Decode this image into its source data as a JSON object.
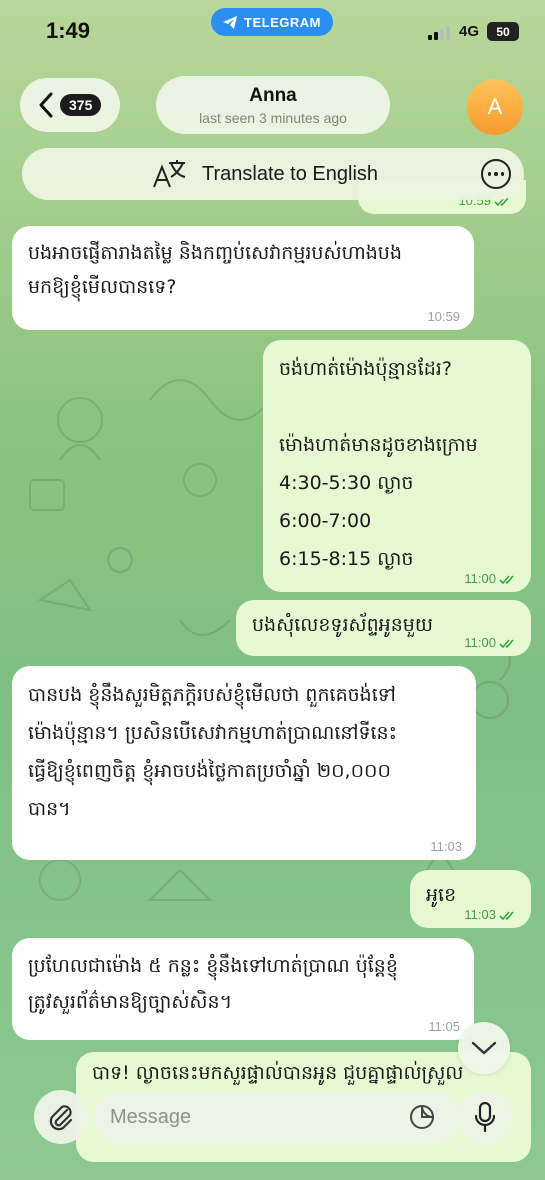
{
  "status_bar": {
    "time": "1:49",
    "banner": "TELEGRAM",
    "network": "4G",
    "battery": "50"
  },
  "header": {
    "unread_count": "375",
    "contact_name": "Anna",
    "last_seen": "last seen 3 minutes ago",
    "avatar_initial": "A"
  },
  "translate_bar": {
    "label": "Translate to English"
  },
  "partial_top_message": {
    "time": "10:59"
  },
  "messages": [
    {
      "direction": "in",
      "text": "បងអាចផ្ញើតារាងតម្លៃ និងកញ្ចប់សេវាកម្មរបស់ហាងបង\nមកឱ្យខ្ញុំមើលបានទេ?",
      "time": "10:59"
    },
    {
      "direction": "out",
      "text": "ចង់ហាត់ម៉ោងប៉ុន្មានដែរ?\n\nម៉ោងហាត់មានដូចខាងក្រោម\n4:30-5:30 ល្ងាច\n6:00-7:00\n6:15-8:15 ល្ងាច",
      "time": "11:00"
    },
    {
      "direction": "out",
      "text": "បងសុំលេខទូរស័ព្ទអូនមួយ",
      "time": "11:00"
    },
    {
      "direction": "in",
      "text": "បានបង ខ្ញុំនឹងសួរមិត្តភក្តិរបស់ខ្ញុំមើលថា ពួកគេចង់ទៅ\nម៉ោងប៉ុន្មាន។ ប្រសិនបើសេវាកម្មហាត់ប្រាណនៅទីនេះ\nធ្វើឱ្យខ្ញុំពេញចិត្ត ខ្ញុំអាចបង់ថ្លៃកាតប្រចាំឆ្នាំ ២០,០០០\nបាន។",
      "time": "11:03"
    },
    {
      "direction": "out",
      "text": "អូខេ",
      "time": "11:03"
    },
    {
      "direction": "in",
      "text": "ប្រហែលជាម៉ោង ៥ កន្លះ ខ្ញុំនឹងទៅហាត់ប្រាណ ប៉ុន្តែខ្ញុំ\nត្រូវសួរព័ត៌មានឱ្យច្បាស់សិន។",
      "time": "11:05"
    },
    {
      "direction": "out",
      "text": "បាទ! ល្ងាចនេះមកសួរផ្ទាល់បានអូន ជួបគ្នាផ្ទាល់ស្រួល",
      "time": ""
    }
  ],
  "composer": {
    "placeholder": "Message"
  },
  "colors": {
    "incoming": "#ffffff",
    "outgoing": "#e6f9d3",
    "accent": "#2a8ff0",
    "check": "#3fa33a"
  },
  "icons": {
    "back": "chevron-left-icon",
    "translate": "translate-icon",
    "more": "more-icon",
    "scroll": "chevron-down-icon",
    "attach": "paperclip-icon",
    "sticker": "sticker-icon",
    "mic": "microphone-icon"
  }
}
